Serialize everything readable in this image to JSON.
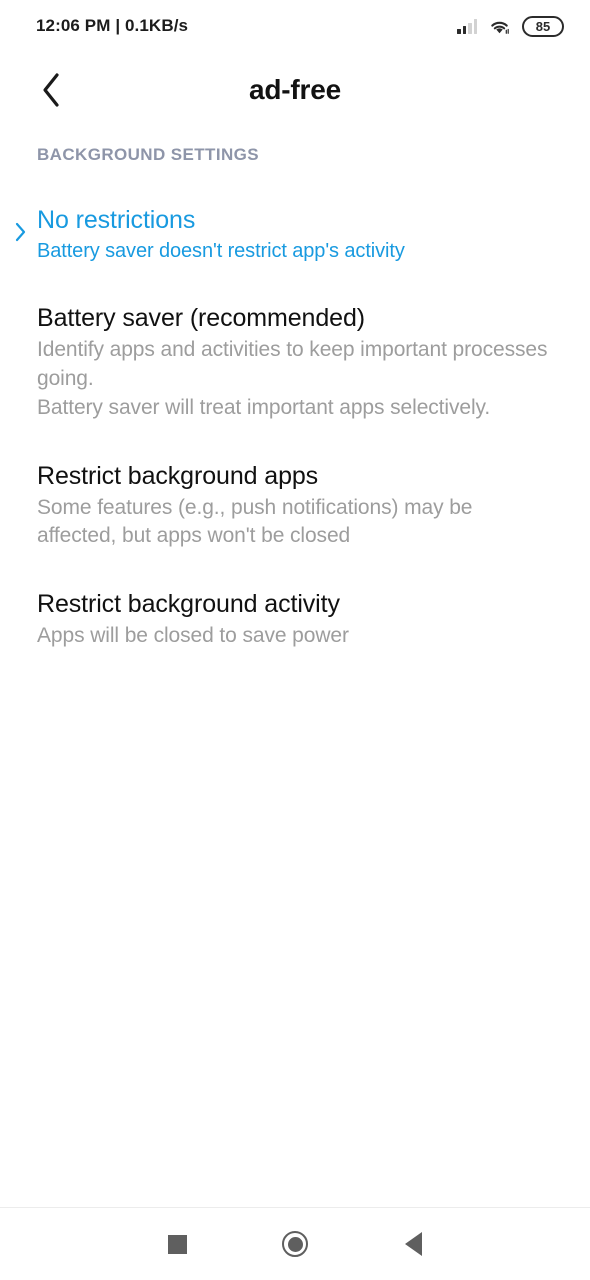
{
  "statusbar": {
    "left_text": "12:06 PM | 0.1KB/s",
    "signal_icon": "signal-bars-icon",
    "signal_bars_filled": 2,
    "signal_bars_total": 4,
    "wifi_icon": "wifi-icon",
    "battery_level": "85"
  },
  "appbar": {
    "back_icon": "back-chevron-icon",
    "title": "ad-free"
  },
  "content": {
    "section_label": "BACKGROUND SETTINGS",
    "options": [
      {
        "title": "No restrictions",
        "desc": "Battery saver doesn't restrict app's activity",
        "selected": true,
        "marker_icon": "chevron-right-icon"
      },
      {
        "title": "Battery saver (recommended)",
        "desc": "Identify apps and activities to keep important processes going.\nBattery saver will treat important apps selectively.",
        "selected": false
      },
      {
        "title": "Restrict background apps",
        "desc": "Some features (e.g., push notifications) may be affected, but apps won't be closed",
        "selected": false
      },
      {
        "title": "Restrict background activity",
        "desc": "Apps will be closed to save power",
        "selected": false
      }
    ]
  },
  "navbar": {
    "recents_icon": "square-recents-icon",
    "home_icon": "circle-home-icon",
    "back_icon": "triangle-back-icon"
  },
  "colors": {
    "accent_blue": "#189ae0",
    "section_label": "#8e95a9",
    "title_black": "#111111",
    "desc_gray": "#9d9d9d",
    "nav_gray": "#5f5f5f"
  }
}
